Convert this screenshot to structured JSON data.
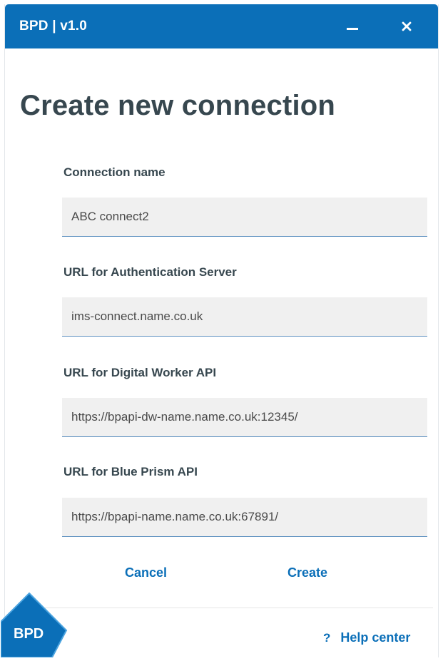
{
  "window": {
    "title": "BPD | v1.0",
    "minimize_icon": "minimize-icon",
    "close_icon": "close-icon"
  },
  "page": {
    "title": "Create new connection"
  },
  "form": {
    "fields": [
      {
        "label": "Connection name",
        "value": "ABC connect2"
      },
      {
        "label": "URL for Authentication Server",
        "value": "ims-connect.name.co.uk"
      },
      {
        "label": "URL for Digital Worker API",
        "value": "https://bpapi-dw-name.name.co.uk:12345/"
      },
      {
        "label": "URL for Blue Prism API",
        "value": "https://bpapi-name.name.co.uk:67891/"
      }
    ]
  },
  "actions": {
    "cancel_label": "Cancel",
    "create_label": "Create"
  },
  "footer": {
    "logo_text": "BPD",
    "help_icon": "?",
    "help_label": "Help center"
  },
  "colors": {
    "brand_blue": "#0b6fb8",
    "title_text": "#37474f",
    "input_bg": "#f0f0f0",
    "input_underline": "#5b8fbf"
  }
}
